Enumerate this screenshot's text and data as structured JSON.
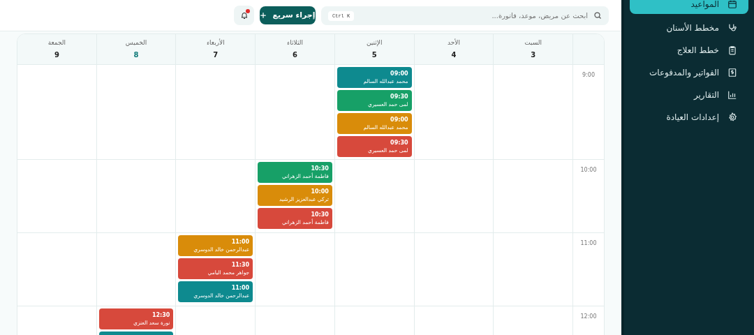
{
  "sidebar": {
    "items": [
      {
        "label": "المواعيد",
        "selected": true
      },
      {
        "label": "مخطط الأسنان",
        "selected": false
      },
      {
        "label": "خطط العلاج",
        "selected": false
      },
      {
        "label": "الفواتير والمدفوعات",
        "selected": false
      },
      {
        "label": "التقارير",
        "selected": false
      },
      {
        "label": "إعدادات العيادة",
        "selected": false
      }
    ]
  },
  "header": {
    "search": {
      "placeholder": "ابحث عن مريض، موعد، فاتورة...",
      "shortcut": "Ctrl K"
    },
    "quick_action": "إجراء سريع",
    "notifications": {
      "unread": true
    }
  },
  "calendar": {
    "days": [
      {
        "name": "السبت",
        "date": "3",
        "selected": false
      },
      {
        "name": "الأحد",
        "date": "4",
        "selected": false
      },
      {
        "name": "الإثنين",
        "date": "5",
        "selected": false
      },
      {
        "name": "الثلاثاء",
        "date": "6",
        "selected": false
      },
      {
        "name": "الأربعاء",
        "date": "7",
        "selected": false
      },
      {
        "name": "الخميس",
        "date": "8",
        "selected": true
      },
      {
        "name": "الجمعة",
        "date": "9",
        "selected": false
      }
    ],
    "rows": [
      {
        "time": "9:00",
        "cells": [
          [],
          [],
          [
            {
              "time": "09:00",
              "patient": "محمد عبدالله السالم",
              "color": "#0e8a8f"
            },
            {
              "time": "09:30",
              "patient": "لمى حمد العسيري",
              "color": "#17a067"
            },
            {
              "time": "09:00",
              "patient": "محمد عبدالله السالم",
              "color": "#d98c0a"
            },
            {
              "time": "09:30",
              "patient": "لمى حمد العسيري",
              "color": "#d7493c"
            }
          ],
          [],
          [],
          [],
          []
        ]
      },
      {
        "time": "10:00",
        "cells": [
          [],
          [],
          [],
          [
            {
              "time": "10:30",
              "patient": "فاطمة أحمد الزهراني",
              "color": "#17a067"
            },
            {
              "time": "10:00",
              "patient": "تركي عبدالعزيز الرشيد",
              "color": "#d98c0a"
            },
            {
              "time": "10:30",
              "patient": "فاطمة أحمد الزهراني",
              "color": "#d7493c"
            }
          ],
          [],
          [],
          []
        ]
      },
      {
        "time": "11:00",
        "cells": [
          [],
          [],
          [],
          [],
          [
            {
              "time": "11:00",
              "patient": "عبدالرحمن خالد الدوسري",
              "color": "#d98c0a"
            },
            {
              "time": "11:30",
              "patient": "جواهر محمد اليامي",
              "color": "#d7493c"
            },
            {
              "time": "11:00",
              "patient": "عبدالرحمن خالد الدوسري",
              "color": "#0e8a8f"
            }
          ],
          [],
          []
        ]
      },
      {
        "time": "12:00",
        "cells": [
          [],
          [],
          [],
          [],
          [],
          [
            {
              "time": "12:30",
              "patient": "نورة سعد العنزي",
              "color": "#d7493c"
            },
            {
              "color": "#0e8a8f"
            }
          ],
          []
        ]
      }
    ]
  }
}
